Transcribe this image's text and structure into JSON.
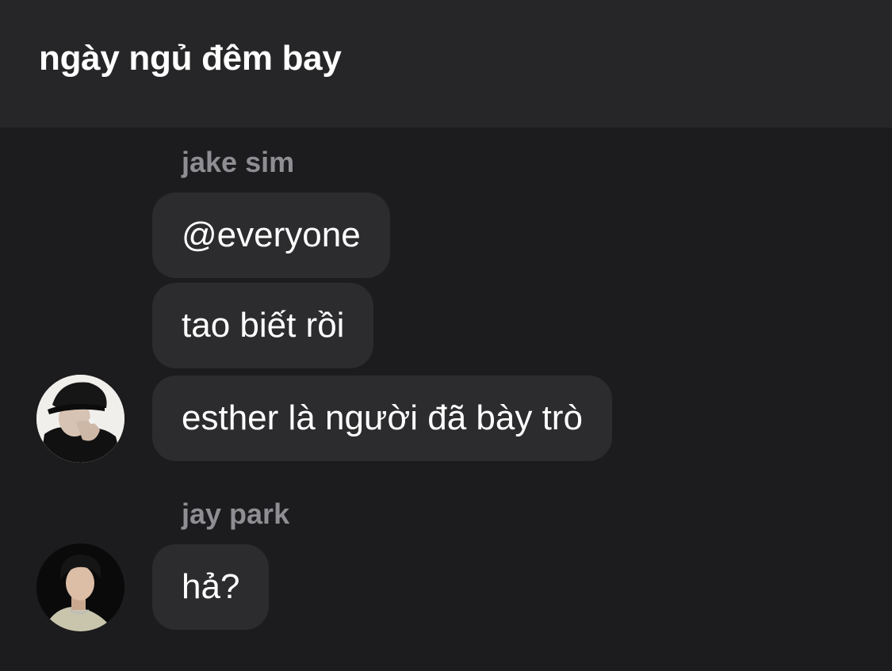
{
  "header": {
    "title": "ngày ngủ đêm bay"
  },
  "messages": {
    "group1": {
      "sender": "jake sim",
      "bubbles": [
        "@everyone",
        "tao biết rồi",
        "esther là người đã bày trò"
      ]
    },
    "group2": {
      "sender": "jay park",
      "bubbles": [
        "hả?"
      ]
    }
  },
  "colors": {
    "background": "#1c1c1e",
    "header_background": "#262628",
    "bubble_background": "#2c2c2e",
    "sender_name": "#8e8e93",
    "text": "#ffffff"
  },
  "icons": {
    "avatar_1": "user-avatar-jake",
    "avatar_2": "user-avatar-jay"
  }
}
